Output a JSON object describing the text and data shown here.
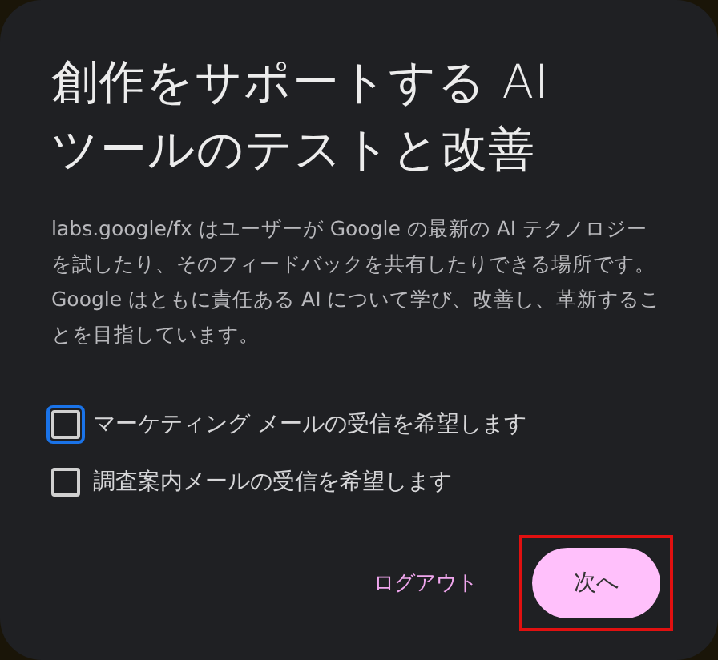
{
  "dialog": {
    "title": "創作をサポートする AI ツールのテストと改善",
    "description": "labs.google/fx はユーザーが Google の最新の AI テクノロジーを試したり、そのフィードバックを共有したりできる場所です。Google はともに責任ある AI について学び、改善し、革新することを目指しています。",
    "checkboxes": [
      {
        "label": "マーケティング メールの受信を希望します",
        "checked": false,
        "focused": true
      },
      {
        "label": "調査案内メールの受信を希望します",
        "checked": false,
        "focused": false
      }
    ],
    "buttons": [
      {
        "label": "ログアウト",
        "kind": "text",
        "highlighted": false
      },
      {
        "label": "次へ",
        "kind": "filled",
        "highlighted": true
      }
    ]
  }
}
